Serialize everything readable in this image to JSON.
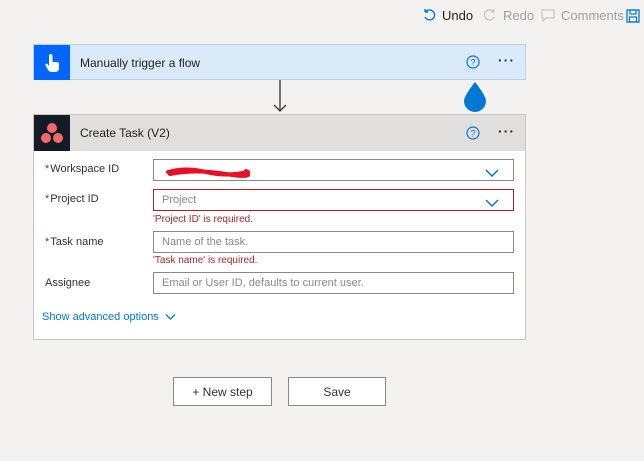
{
  "toolbar": {
    "undo_label": "Undo",
    "redo_label": "Redo",
    "comments_label": "Comments"
  },
  "trigger": {
    "title": "Manually trigger a flow"
  },
  "action": {
    "title": "Create Task (V2)",
    "fields": [
      {
        "label": "Workspace ID",
        "required": true,
        "value": "(redacted)",
        "placeholder": "",
        "error": ""
      },
      {
        "label": "Project ID",
        "required": true,
        "value": "",
        "placeholder": "Project",
        "error": "'Project ID' is required."
      },
      {
        "label": "Task name",
        "required": true,
        "value": "",
        "placeholder": "Name of the task.",
        "error": "'Task name' is required."
      },
      {
        "label": "Assignee",
        "required": false,
        "value": "",
        "placeholder": "Email or User ID, defaults to current user.",
        "error": ""
      }
    ],
    "required_marker": "*",
    "advanced_label": "Show advanced options"
  },
  "buttons": {
    "new_step_label": "+ New step",
    "save_label": "Save"
  },
  "colors": {
    "trigger_icon_bg": "#0066ff",
    "accent_blue": "#0078d4",
    "error_red": "#a4262c",
    "asana_pink": "#f06a6a"
  },
  "icons": {
    "undo": "undo-icon",
    "redo": "redo-icon",
    "comments": "comment-icon",
    "save": "save-icon",
    "trigger": "hand-touch-icon",
    "help": "help-icon",
    "more": "more-icon",
    "asana": "asana-logo-icon",
    "chevron": "chevron-down-icon"
  }
}
